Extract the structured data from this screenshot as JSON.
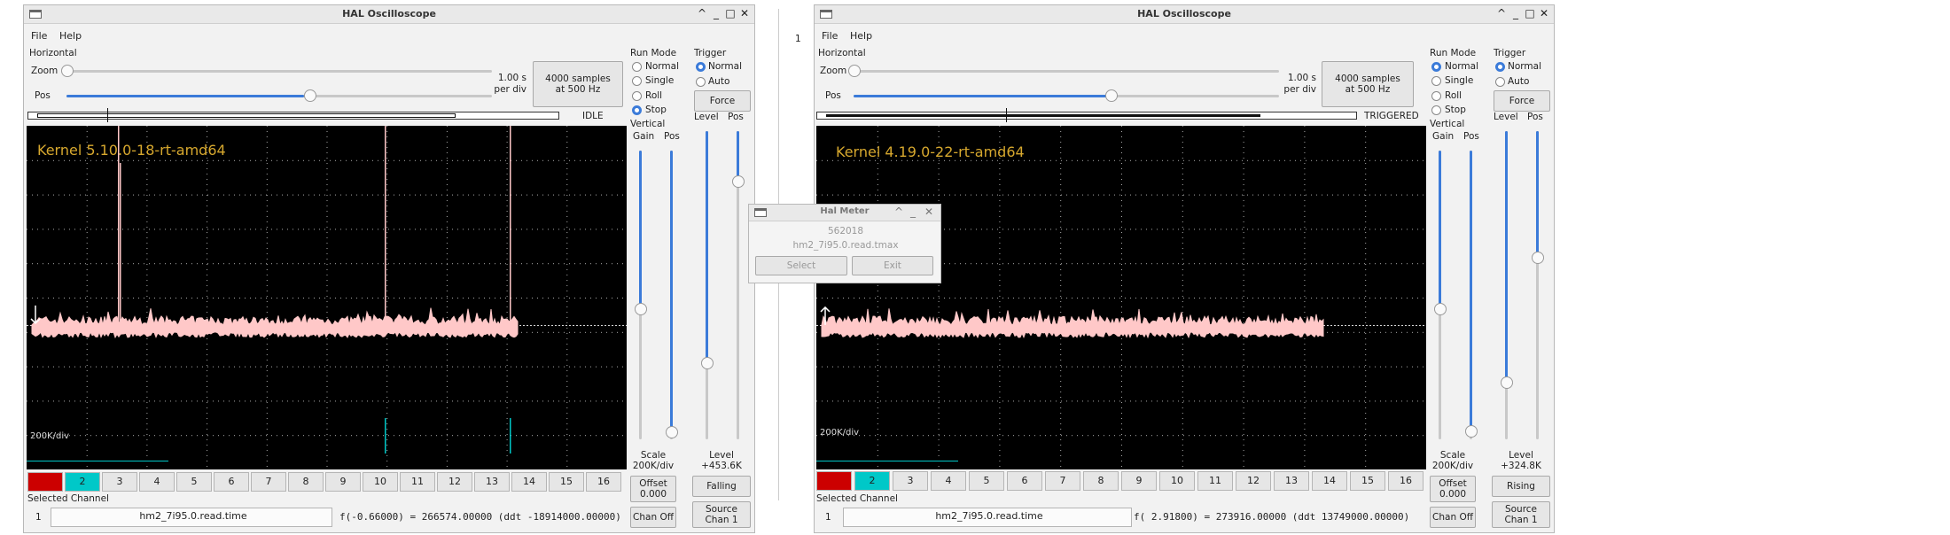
{
  "left": {
    "title": "HAL Oscilloscope",
    "menu": [
      "File",
      "Help"
    ],
    "horizontal_label": "Horizontal",
    "zoom_label": "Zoom",
    "pos_label": "Pos",
    "time_per_div": [
      "1.00 s",
      "per div"
    ],
    "samples": [
      "4000 samples",
      "at 500 Hz"
    ],
    "status": "IDLE",
    "kernel": "Kernel 5.10.0-18-rt-amd64",
    "scale_overlay": "200K/div",
    "run_mode_label": "Run Mode",
    "run_modes": [
      "Normal",
      "Single",
      "Roll",
      "Stop"
    ],
    "run_mode_selected": "Stop",
    "trigger_label": "Trigger",
    "trigger_modes": [
      "Normal",
      "Auto"
    ],
    "trigger_selected": "Normal",
    "force_label": "Force",
    "vertical_label": "Vertical",
    "gain_label": "Gain",
    "vpos_label": "Pos",
    "level_label": "Level",
    "tpos_label": "Pos",
    "scale_label": "Scale",
    "scale_value": "200K/div",
    "offset_label": "Offset",
    "offset_value": "0.000",
    "chan_off_label": "Chan Off",
    "trigger_level_label": "Level",
    "trigger_level_value": "+453.6K",
    "edge_label": "Falling",
    "source_label": "Source",
    "source_value": "Chan  1",
    "channels": [
      "1",
      "2",
      "3",
      "4",
      "5",
      "6",
      "7",
      "8",
      "9",
      "10",
      "11",
      "12",
      "13",
      "14",
      "15",
      "16"
    ],
    "selected_channel_label": "Selected Channel",
    "selected_channel_num": "1",
    "pin_name": "hm2_7i95.0.read.time",
    "readout": "f(-0.66000) =  266574.00000 (ddt -18914000.00000)"
  },
  "right": {
    "title": "HAL Oscilloscope",
    "menu": [
      "File",
      "Help"
    ],
    "horizontal_label": "Horizontal",
    "zoom_label": "Zoom",
    "pos_label": "Pos",
    "time_per_div": [
      "1.00 s",
      "per div"
    ],
    "samples": [
      "4000 samples",
      "at 500 Hz"
    ],
    "status": "TRIGGERED",
    "kernel": "Kernel 4.19.0-22-rt-amd64",
    "scale_overlay": "200K/div",
    "run_mode_label": "Run Mode",
    "run_modes": [
      "Normal",
      "Single",
      "Roll",
      "Stop"
    ],
    "run_mode_selected": "Normal",
    "trigger_label": "Trigger",
    "trigger_modes": [
      "Normal",
      "Auto"
    ],
    "trigger_selected": "Normal",
    "force_label": "Force",
    "vertical_label": "Vertical",
    "gain_label": "Gain",
    "vpos_label": "Pos",
    "level_label": "Level",
    "tpos_label": "Pos",
    "scale_label": "Scale",
    "scale_value": "200K/div",
    "offset_label": "Offset",
    "offset_value": "0.000",
    "chan_off_label": "Chan Off",
    "trigger_level_label": "Level",
    "trigger_level_value": "+324.8K",
    "edge_label": "Rising",
    "source_label": "Source",
    "source_value": "Chan  1",
    "channels": [
      "1",
      "2",
      "3",
      "4",
      "5",
      "6",
      "7",
      "8",
      "9",
      "10",
      "11",
      "12",
      "13",
      "14",
      "15",
      "16"
    ],
    "selected_channel_label": "Selected Channel",
    "selected_channel_num": "1",
    "pin_name": "hm2_7i95.0.read.time",
    "readout": "f( 2.91800) =  273916.00000 (ddt  13749000.00000)"
  },
  "meter": {
    "title": "Hal Meter",
    "value": "562018",
    "pin": "hm2_7i95.0.read.tmax",
    "select_label": "Select",
    "exit_label": "Exit"
  },
  "background_number": "1",
  "colors": {
    "chan1": "#cc0000",
    "chan2": "#00c8c8",
    "trace": "#ffc8c8",
    "kernel_text": "#d7a82e",
    "accent": "#3b7bd9"
  }
}
